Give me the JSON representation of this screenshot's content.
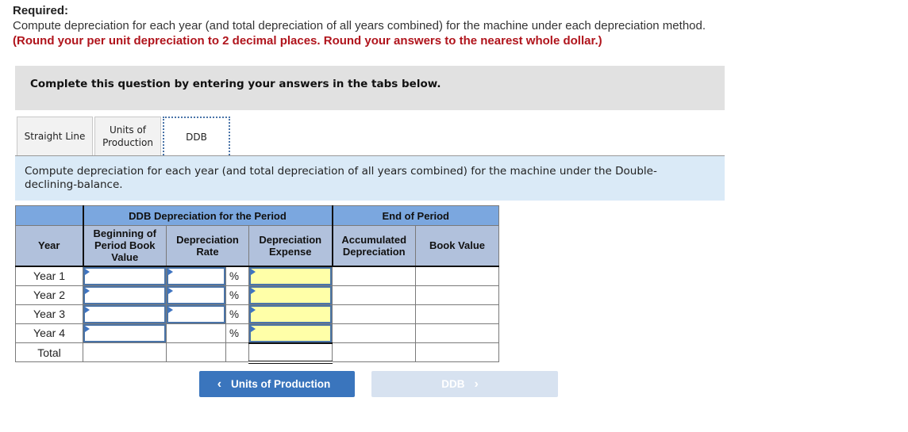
{
  "required": {
    "title": "Required:",
    "text": "Compute depreciation for each year (and total depreciation of all years combined) for the machine under each depreciation method.",
    "note": "(Round your per unit depreciation to 2 decimal places. Round your answers to the nearest whole dollar.)"
  },
  "instructions": "Complete this question by entering your answers in the tabs below.",
  "tabs": [
    {
      "label": "Straight Line",
      "active": false
    },
    {
      "label": "Units of Production",
      "active": false
    },
    {
      "label": "DDB",
      "active": true
    }
  ],
  "description": "Compute depreciation for each year (and total depreciation of all years combined) for the machine under the Double-declining-balance.",
  "table": {
    "group_headers": {
      "ddb_period": "DDB Depreciation for the Period",
      "end_period": "End of Period"
    },
    "columns": {
      "year": "Year",
      "beginning_book_value": "Beginning of Period Book Value",
      "depreciation_rate": "Depreciation Rate",
      "depreciation_expense": "Depreciation Expense",
      "accumulated_depreciation": "Accumulated Depreciation",
      "book_value": "Book Value"
    },
    "percent_symbol": "%",
    "rows": [
      {
        "label": "Year 1",
        "beginning_book_value": "",
        "depreciation_rate": "",
        "depreciation_expense": "",
        "accumulated_depreciation": "",
        "book_value": ""
      },
      {
        "label": "Year 2",
        "beginning_book_value": "",
        "depreciation_rate": "",
        "depreciation_expense": "",
        "accumulated_depreciation": "",
        "book_value": ""
      },
      {
        "label": "Year 3",
        "beginning_book_value": "",
        "depreciation_rate": "",
        "depreciation_expense": "",
        "accumulated_depreciation": "",
        "book_value": ""
      },
      {
        "label": "Year 4",
        "beginning_book_value": "",
        "depreciation_expense": "",
        "accumulated_depreciation": "",
        "book_value": ""
      }
    ],
    "total_label": "Total",
    "total_expense": ""
  },
  "nav": {
    "prev_label": "Units of Production",
    "next_label": "DDB",
    "prev_icon": "chevron-left-icon",
    "next_icon": "chevron-right-icon"
  },
  "colors": {
    "accent_blue": "#3a75bd",
    "warning_red": "#b0141c",
    "input_yellow": "#ffffa8",
    "header_blue": "#7ba7df",
    "subheader_blue": "#b1c1dc"
  }
}
